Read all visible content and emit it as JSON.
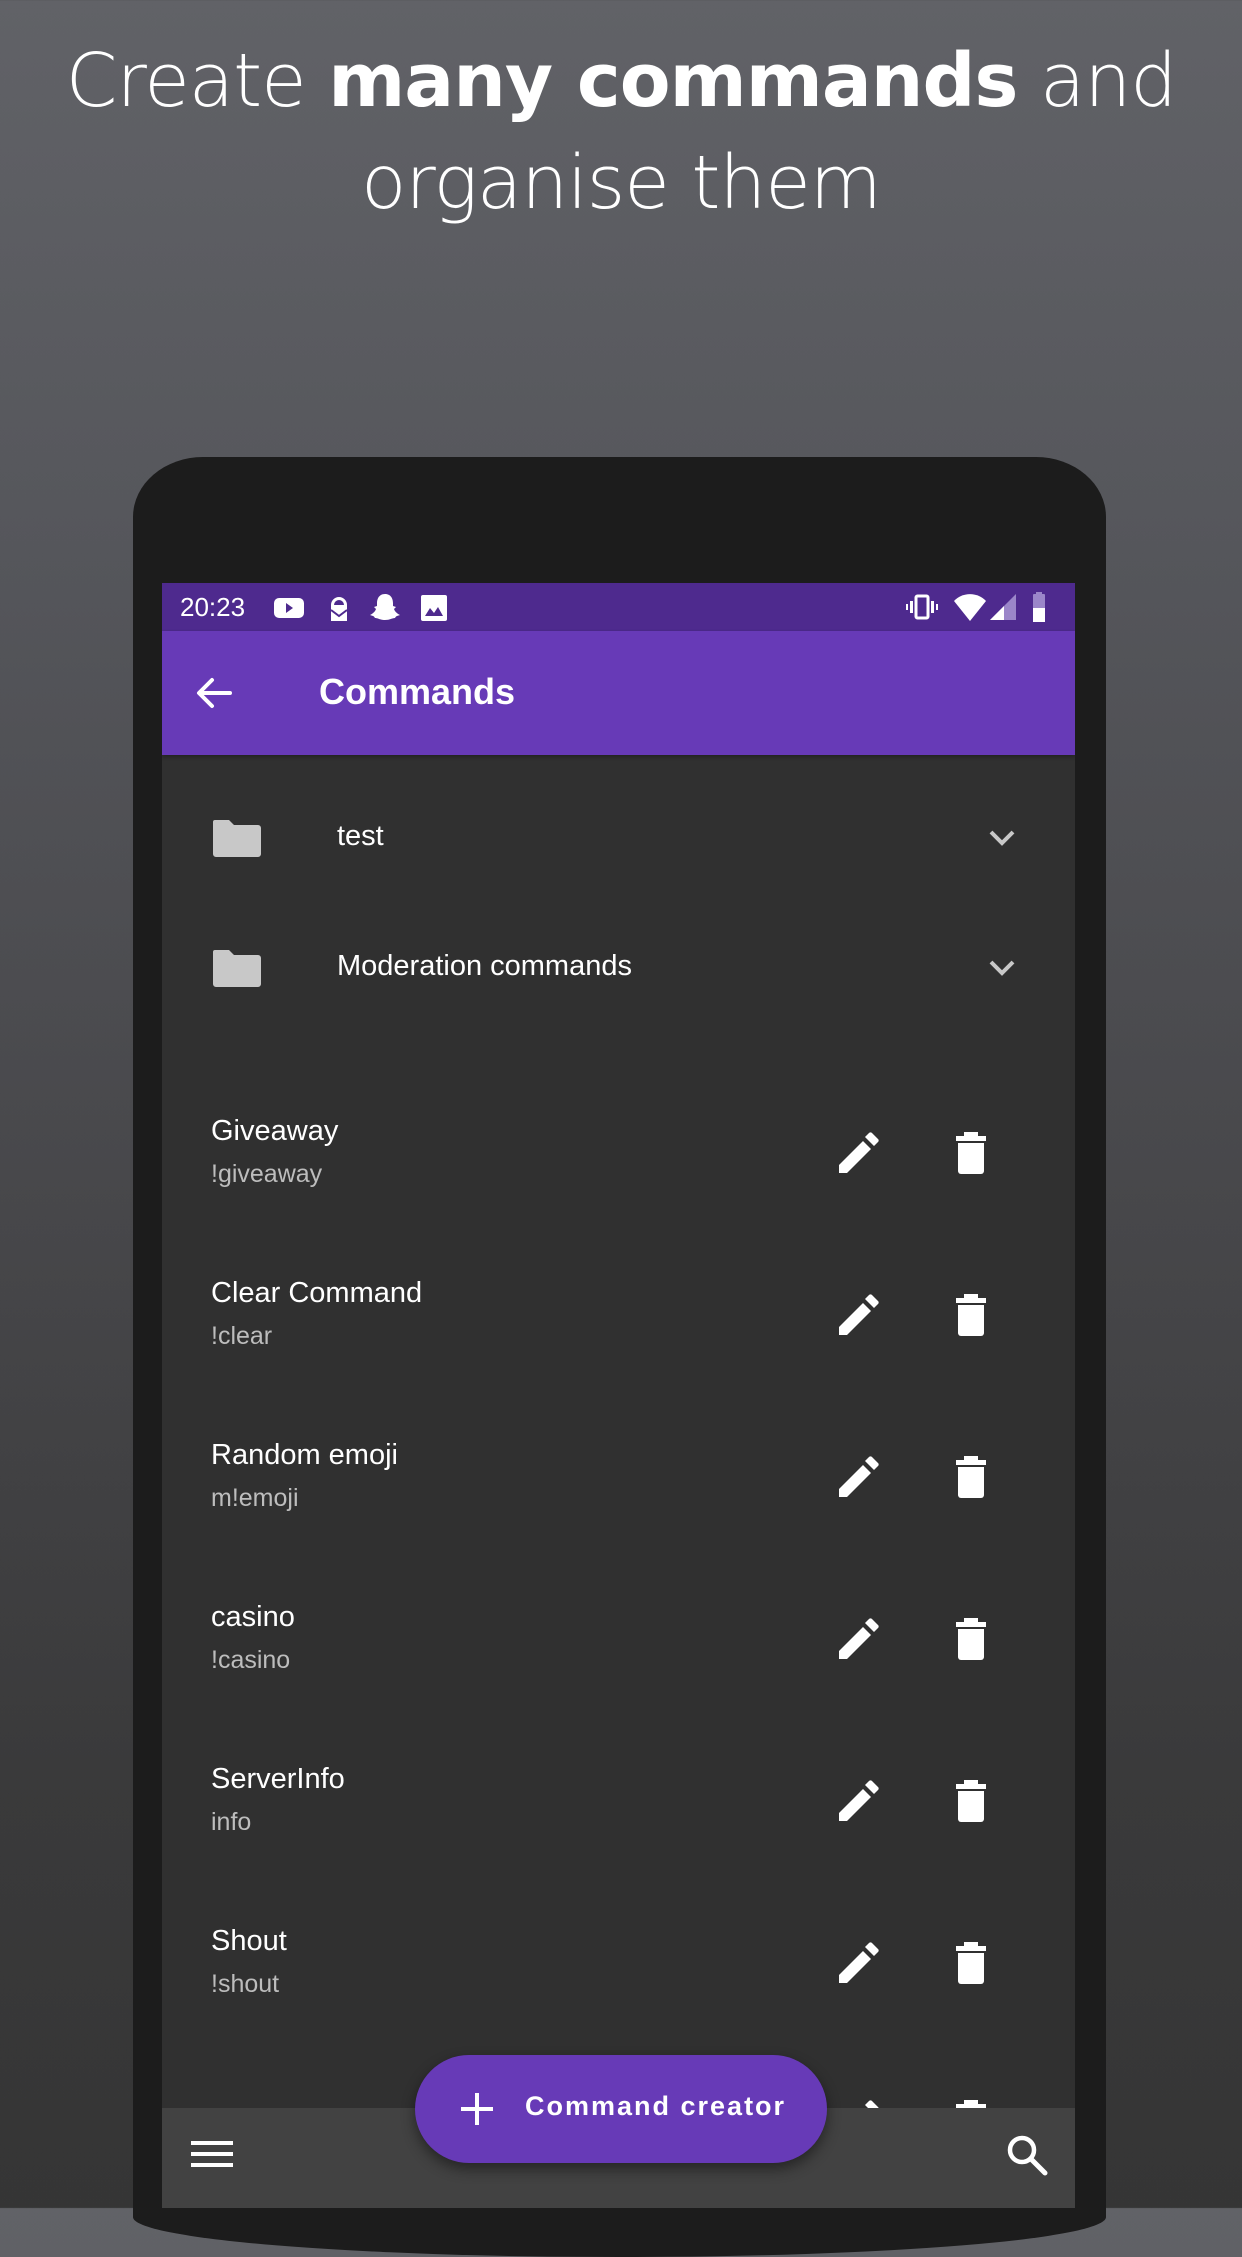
{
  "headline": {
    "prefix": "Create ",
    "bold": "many commands",
    "suffix": " and",
    "line2": "organise them"
  },
  "status_bar": {
    "time": "20:23",
    "notification_icons": [
      "youtube-icon",
      "protonmail-icon",
      "snapchat-icon",
      "gallery-icon"
    ],
    "system_icons": [
      "vibrate-icon",
      "wifi-icon",
      "signal-icon",
      "battery-icon"
    ],
    "battery_level": 0.5
  },
  "app_bar": {
    "back_icon": "arrow-back-icon",
    "title": "Commands"
  },
  "folders": [
    {
      "label": "test",
      "icon": "folder-icon",
      "expand_icon": "chevron-down-icon"
    },
    {
      "label": "Moderation commands",
      "icon": "folder-icon",
      "expand_icon": "chevron-down-icon"
    }
  ],
  "commands": [
    {
      "title": "Giveaway",
      "trigger": "!giveaway"
    },
    {
      "title": "Clear Command",
      "trigger": "!clear"
    },
    {
      "title": "Random emoji",
      "trigger": "m!emoji"
    },
    {
      "title": "casino",
      "trigger": "!casino"
    },
    {
      "title": "ServerInfo",
      "trigger": "info"
    },
    {
      "title": "Shout",
      "trigger": "!shout"
    }
  ],
  "row_actions": {
    "edit_icon": "pencil-icon",
    "delete_icon": "trash-icon"
  },
  "fab": {
    "icon": "plus-icon",
    "label": "Command creator"
  },
  "bottom_bar": {
    "menu_icon": "menu-icon",
    "search_icon": "search-icon"
  },
  "colors": {
    "primary": "#673ab7",
    "primary_dark": "#4e2a8e",
    "surface": "#303030",
    "bottom_bar": "#424242",
    "text_primary": "#ffffff",
    "text_secondary": "#bdbdbd",
    "folder_icon": "#c8c8c8"
  }
}
